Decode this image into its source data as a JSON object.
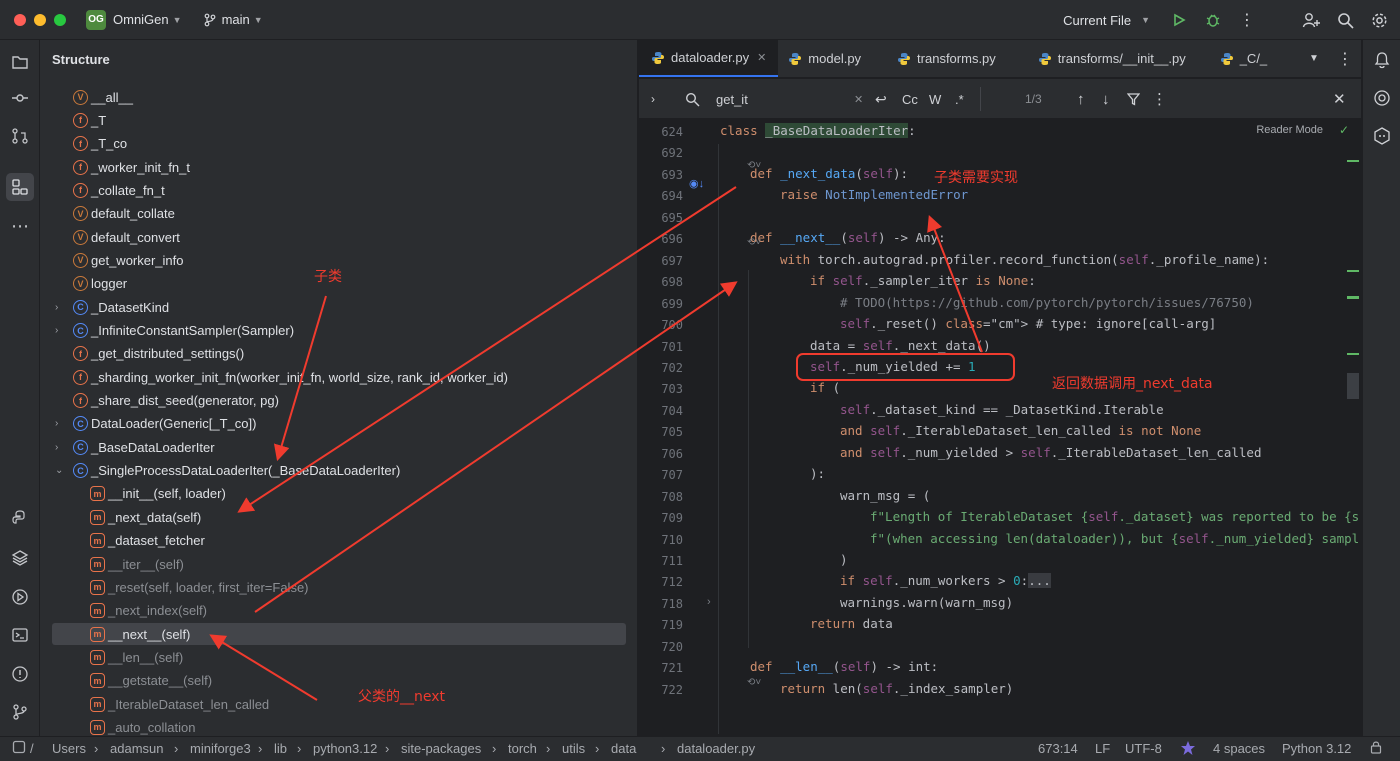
{
  "titlebar": {
    "project_badge": "OG",
    "project_name": "OmniGen",
    "branch": "main",
    "run_config": "Current File"
  },
  "structure": {
    "title": "Structure",
    "items": [
      {
        "label": "__all__",
        "kind": "v-icon"
      },
      {
        "label": "_T",
        "kind": "f-icon"
      },
      {
        "label": "_T_co",
        "kind": "f-icon"
      },
      {
        "label": "_worker_init_fn_t",
        "kind": "f-icon"
      },
      {
        "label": "_collate_fn_t",
        "kind": "f-icon"
      },
      {
        "label": "default_collate",
        "kind": "v-icon"
      },
      {
        "label": "default_convert",
        "kind": "v-icon"
      },
      {
        "label": "get_worker_info",
        "kind": "v-icon"
      },
      {
        "label": "logger",
        "kind": "v-icon"
      },
      {
        "label": "_DatasetKind",
        "kind": "c-icon"
      },
      {
        "label": "_InfiniteConstantSampler(Sampler)",
        "kind": "c-icon"
      },
      {
        "label": "_get_distributed_settings()",
        "kind": "f-icon"
      },
      {
        "label": "_sharding_worker_init_fn(worker_init_fn, world_size, rank_id, worker_id)",
        "kind": "f-icon"
      },
      {
        "label": "_share_dist_seed(generator, pg)",
        "kind": "f-icon"
      },
      {
        "label": "DataLoader(Generic[_T_co])",
        "kind": "c-icon"
      },
      {
        "label": "_BaseDataLoaderIter",
        "kind": "c-icon"
      },
      {
        "label": "_SingleProcessDataLoaderIter(_BaseDataLoaderIter)",
        "kind": "c-icon"
      },
      {
        "label": "__init__(self, loader)",
        "kind": "m-icon"
      },
      {
        "label": "_next_data(self)",
        "kind": "m-icon"
      },
      {
        "label": "_dataset_fetcher",
        "kind": "m-icon"
      },
      {
        "label": "__iter__(self)",
        "kind": "m-icon"
      },
      {
        "label": "_reset(self, loader, first_iter=False)",
        "kind": "m-icon"
      },
      {
        "label": "_next_index(self)",
        "kind": "m-icon"
      },
      {
        "label": "__next__(self)",
        "kind": "m-icon"
      },
      {
        "label": "__len__(self)",
        "kind": "m-icon"
      },
      {
        "label": "__getstate__(self)",
        "kind": "m-icon"
      },
      {
        "label": "_IterableDataset_len_called",
        "kind": "m-icon"
      },
      {
        "label": "_auto_collation",
        "kind": "m-icon"
      }
    ]
  },
  "tabs": [
    {
      "label": "dataloader.py",
      "active": true
    },
    {
      "label": "model.py"
    },
    {
      "label": "transforms.py"
    },
    {
      "label": "transforms/__init__.py"
    },
    {
      "label": "_C/_"
    }
  ],
  "find": {
    "query": "get_it",
    "match_case": "Cc",
    "words": "W",
    "regex": ".*",
    "count": "1/3"
  },
  "editor": {
    "reader_mode": "Reader Mode",
    "lines": [
      {
        "n": "624",
        "code": "class _BaseDataLoaderIter:"
      },
      {
        "n": "692",
        "code": ""
      },
      {
        "n": "693",
        "code": "def _next_data(self):"
      },
      {
        "n": "694",
        "code": "raise NotImplementedError"
      },
      {
        "n": "695",
        "code": ""
      },
      {
        "n": "696",
        "code": "def __next__(self) -> Any:"
      },
      {
        "n": "697",
        "code": "with torch.autograd.profiler.record_function(self._profile_name):"
      },
      {
        "n": "698",
        "code": "if self._sampler_iter is None:"
      },
      {
        "n": "699",
        "code": "# TODO(https://github.com/pytorch/pytorch/issues/76750)"
      },
      {
        "n": "700",
        "code": "self._reset()  # type: ignore[call-arg]"
      },
      {
        "n": "701",
        "code": "data = self._next_data()"
      },
      {
        "n": "702",
        "code": "self._num_yielded += 1"
      },
      {
        "n": "703",
        "code": "if ("
      },
      {
        "n": "704",
        "code": "self._dataset_kind == _DatasetKind.Iterable"
      },
      {
        "n": "705",
        "code": "and self._IterableDataset_len_called is not None"
      },
      {
        "n": "706",
        "code": "and self._num_yielded > self._IterableDataset_len_called"
      },
      {
        "n": "707",
        "code": "):"
      },
      {
        "n": "708",
        "code": "warn_msg = ("
      },
      {
        "n": "709",
        "code": "f\"Length of IterableDataset {self._dataset} was reported to be {s"
      },
      {
        "n": "710",
        "code": "f\"(when accessing len(dataloader)), but {self._num_yielded} sampl"
      },
      {
        "n": "711",
        "code": ")"
      },
      {
        "n": "712",
        "code": "if self._num_workers > 0:..."
      },
      {
        "n": "718",
        "code": "warnings.warn(warn_msg)"
      },
      {
        "n": "719",
        "code": "return data"
      },
      {
        "n": "720",
        "code": ""
      },
      {
        "n": "721",
        "code": "def __len__(self) -> int:"
      },
      {
        "n": "722",
        "code": "return len(self._index_sampler)"
      }
    ]
  },
  "annotations": {
    "subclass": "子类",
    "subclass_must_impl": "子类需要实现",
    "returns_data_calls": "返回数据调用_next_data",
    "parent_next": "父类的__next"
  },
  "statusbar": {
    "path": [
      "Users",
      "adamsun",
      "miniforge3",
      "lib",
      "python3.12",
      "site-packages",
      "torch",
      "utils",
      "data",
      "dataloader.py"
    ],
    "position": "673:14",
    "line_sep": "LF",
    "encoding": "UTF-8",
    "indent": "4 spaces",
    "interpreter": "Python 3.12"
  },
  "colors": {
    "accent": "#3574f0",
    "annotation_red": "#f03b2e"
  }
}
